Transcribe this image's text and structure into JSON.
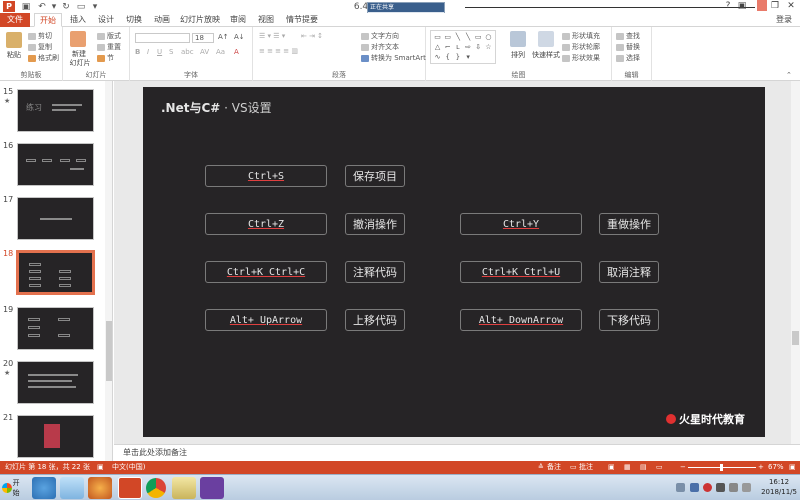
{
  "window": {
    "version_label": "6.4",
    "floating_toolbar_title": "正在共享",
    "min_icon": "−",
    "restore_icon": "❐",
    "close_icon": "✕",
    "help_icon": "?"
  },
  "quick_access": {
    "save_icon": "save-icon",
    "undo_icon": "undo-icon",
    "redo_icon": "redo-icon",
    "customize_icon": "customize-icon"
  },
  "tabs": [
    "文件",
    "开始",
    "插入",
    "设计",
    "切换",
    "动画",
    "幻灯片放映",
    "审阅",
    "视图",
    "情节提要"
  ],
  "login": "登录",
  "ribbon": {
    "clipboard": {
      "paste": "粘贴",
      "cut": "剪切",
      "copy": "复制",
      "format_painter": "格式刷",
      "label": "剪贴板"
    },
    "slides": {
      "new_slide": "新建",
      "new_slide_sub": "幻灯片",
      "layout": "版式",
      "reset": "重置",
      "section": "节",
      "label": "幻灯片"
    },
    "font": {
      "font_size": "18",
      "label": "字体"
    },
    "paragraph": {
      "text_direction": "文字方向",
      "align_text": "对齐文本",
      "convert_smartart": "转换为 SmartArt",
      "label": "段落"
    },
    "drawing": {
      "arrange": "排列",
      "quick_styles": "快速样式",
      "shape_fill": "形状填充",
      "shape_outline": "形状轮廓",
      "shape_effects": "形状效果",
      "label": "绘图"
    },
    "editing": {
      "find": "查找",
      "replace": "替换",
      "select": "选择",
      "label": "编辑"
    }
  },
  "slides_panel": [
    {
      "num": "15",
      "star": "★"
    },
    {
      "num": "16",
      "star": ""
    },
    {
      "num": "17",
      "star": ""
    },
    {
      "num": "18",
      "star": ""
    },
    {
      "num": "19",
      "star": ""
    },
    {
      "num": "20",
      "star": "★"
    },
    {
      "num": "21",
      "star": ""
    }
  ],
  "slide15_text": "练习",
  "slide": {
    "title_prefix": ".Net与C#",
    "title_suffix": " · VS设置",
    "brand": "火星时代教育",
    "shortcuts": [
      {
        "keys": "Ctrl+S",
        "action": "保存项目"
      },
      {
        "keys": "Ctrl+Z",
        "action": "撤消操作"
      },
      {
        "keys": "Ctrl+Y",
        "action": "重做操作"
      },
      {
        "keys": "Ctrl+K Ctrl+C",
        "action": "注释代码"
      },
      {
        "keys": "Ctrl+K Ctrl+U",
        "action": "取消注释"
      },
      {
        "keys": "Alt+ UpArrow",
        "action": "上移代码"
      },
      {
        "keys": "Alt+ DownArrow",
        "action": "下移代码"
      }
    ]
  },
  "notes_placeholder": "单击此处添加备注",
  "statusbar": {
    "slide_info": "幻灯片 第 18 张，共 22 张",
    "language": "中文(中国)",
    "notes": "备注",
    "comments": "批注",
    "zoom": "67%"
  },
  "taskbar": {
    "start": "开始",
    "time": "16:12",
    "date": "2018/11/5"
  }
}
